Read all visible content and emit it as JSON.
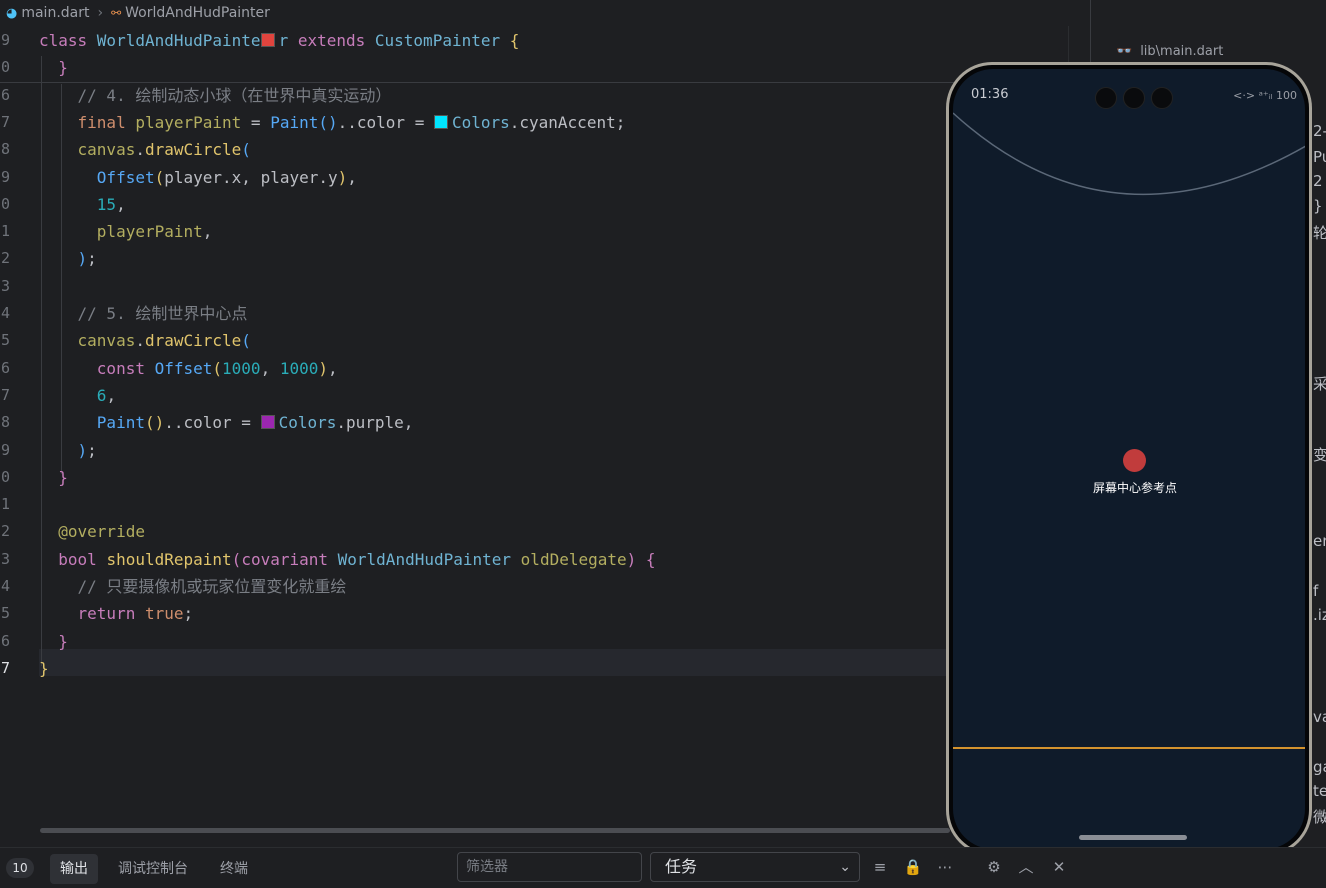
{
  "breadcrumb": {
    "file": "main.dart",
    "symbol": "WorldAndHudPainter"
  },
  "editor": {
    "lines": [
      {
        "num": "9",
        "tokens": [
          [
            "kw2",
            "class "
          ],
          [
            "cls",
            "WorldAndHudPainte"
          ],
          [
            "sw:#e0443e",
            ""
          ],
          [
            "cls",
            "r "
          ],
          [
            "kw2",
            "extends "
          ],
          [
            "cls",
            "CustomPainter "
          ],
          [
            "br1",
            "{"
          ]
        ]
      },
      {
        "num": "0",
        "tokens": [
          [
            "pl",
            "  "
          ],
          [
            "br2",
            "}"
          ]
        ]
      },
      {
        "num": "6",
        "tokens": [
          [
            "cm",
            "    // 4. 绘制动态小球（在世界中真实运动）"
          ]
        ]
      },
      {
        "num": "7",
        "tokens": [
          [
            "pl",
            "    "
          ],
          [
            "kw",
            "final "
          ],
          [
            "an",
            "playerPaint "
          ],
          [
            "pl",
            "= "
          ],
          [
            "ty",
            "Paint"
          ],
          [
            "br3",
            "()"
          ],
          [
            "pl",
            "..color = "
          ],
          [
            "sw:#00e5ff",
            ""
          ],
          [
            "cls",
            "Colors"
          ],
          [
            "pl",
            ".cyanAccent;"
          ]
        ]
      },
      {
        "num": "8",
        "tokens": [
          [
            "pl",
            "    "
          ],
          [
            "an",
            "canvas"
          ],
          [
            "pl",
            "."
          ],
          [
            "fn",
            "drawCircle"
          ],
          [
            "br3",
            "("
          ]
        ]
      },
      {
        "num": "9",
        "tokens": [
          [
            "pl",
            "      "
          ],
          [
            "ty",
            "Offset"
          ],
          [
            "br1",
            "("
          ],
          [
            "pl",
            "player.x, player.y"
          ],
          [
            "br1",
            ")"
          ],
          [
            "pl",
            ","
          ]
        ]
      },
      {
        "num": "0",
        "tokens": [
          [
            "pl",
            "      "
          ],
          [
            "num",
            "15"
          ],
          [
            "pl",
            ","
          ]
        ]
      },
      {
        "num": "1",
        "tokens": [
          [
            "pl",
            "      "
          ],
          [
            "an",
            "playerPaint"
          ],
          [
            "pl",
            ","
          ]
        ]
      },
      {
        "num": "2",
        "tokens": [
          [
            "pl",
            "    "
          ],
          [
            "br3",
            ")"
          ],
          [
            "pl",
            ";"
          ]
        ]
      },
      {
        "num": "3",
        "tokens": []
      },
      {
        "num": "4",
        "tokens": [
          [
            "cm",
            "    // 5. 绘制世界中心点"
          ]
        ]
      },
      {
        "num": "5",
        "tokens": [
          [
            "pl",
            "    "
          ],
          [
            "an",
            "canvas"
          ],
          [
            "pl",
            "."
          ],
          [
            "fn",
            "drawCircle"
          ],
          [
            "br3",
            "("
          ]
        ]
      },
      {
        "num": "6",
        "tokens": [
          [
            "pl",
            "      "
          ],
          [
            "kw2",
            "const "
          ],
          [
            "ty",
            "Offset"
          ],
          [
            "br1",
            "("
          ],
          [
            "num",
            "1000"
          ],
          [
            "pl",
            ", "
          ],
          [
            "num",
            "1000"
          ],
          [
            "br1",
            ")"
          ],
          [
            "pl",
            ","
          ]
        ]
      },
      {
        "num": "7",
        "tokens": [
          [
            "pl",
            "      "
          ],
          [
            "num",
            "6"
          ],
          [
            "pl",
            ","
          ]
        ]
      },
      {
        "num": "8",
        "tokens": [
          [
            "pl",
            "      "
          ],
          [
            "ty",
            "Paint"
          ],
          [
            "br1",
            "()"
          ],
          [
            "pl",
            "..color = "
          ],
          [
            "sw:#9c27b0",
            ""
          ],
          [
            "cls",
            "Colors"
          ],
          [
            "pl",
            ".purple,"
          ]
        ]
      },
      {
        "num": "9",
        "tokens": [
          [
            "pl",
            "    "
          ],
          [
            "br3",
            ")"
          ],
          [
            "pl",
            ";"
          ]
        ]
      },
      {
        "num": "0",
        "tokens": [
          [
            "pl",
            "  "
          ],
          [
            "br2",
            "}"
          ]
        ]
      },
      {
        "num": "1",
        "tokens": []
      },
      {
        "num": "2",
        "tokens": [
          [
            "pl",
            "  "
          ],
          [
            "an",
            "@override"
          ]
        ]
      },
      {
        "num": "3",
        "tokens": [
          [
            "pl",
            "  "
          ],
          [
            "kw2",
            "bool "
          ],
          [
            "fn",
            "shouldRepaint"
          ],
          [
            "br2",
            "("
          ],
          [
            "kw2",
            "covariant "
          ],
          [
            "cls",
            "WorldAndHudPainter "
          ],
          [
            "an",
            "oldDelegate"
          ],
          [
            "br2",
            ") "
          ],
          [
            "br2",
            "{"
          ]
        ]
      },
      {
        "num": "4",
        "tokens": [
          [
            "cm",
            "    // 只要摄像机或玩家位置变化就重绘"
          ]
        ]
      },
      {
        "num": "5",
        "tokens": [
          [
            "pl",
            "    "
          ],
          [
            "kw2",
            "return "
          ],
          [
            "kw",
            "true"
          ],
          [
            "pl",
            ";"
          ]
        ]
      },
      {
        "num": "6",
        "tokens": [
          [
            "pl",
            "  "
          ],
          [
            "br2",
            "}"
          ]
        ]
      },
      {
        "num": "7",
        "tokens": [
          [
            "br1",
            "}"
          ]
        ],
        "current": true
      }
    ]
  },
  "right_panel": {
    "path": "lib\\main.dart",
    "fragments": [
      "2-",
      "Pu",
      "2",
      "}",
      "轮",
      "采",
      "变",
      "en",
      "f",
      ".iz",
      "va",
      "ga",
      "te",
      "微",
      "}"
    ]
  },
  "phone": {
    "time": "01:36",
    "status_right": "<·> ᵃ⁺ᵢₗ 100",
    "center_label": "屏幕中心参考点",
    "colors": {
      "background": "#0f1b2a",
      "dot": "#c13c3c",
      "hud_line": "#d4932e"
    }
  },
  "bottom_panel": {
    "badge": "10",
    "tabs": [
      "输出",
      "调试控制台",
      "终端"
    ],
    "active_tab": "输出",
    "filter_placeholder": "筛选器",
    "task_select": "任务"
  }
}
